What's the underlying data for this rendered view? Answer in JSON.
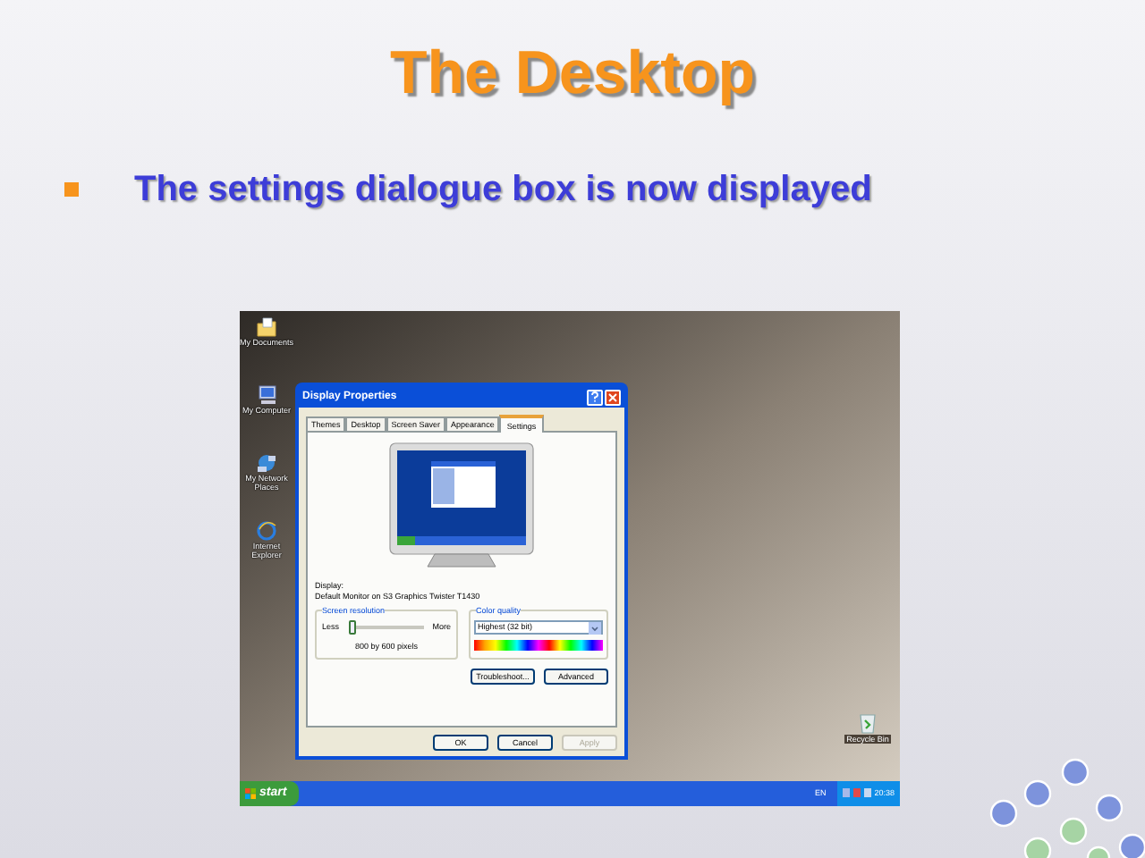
{
  "slide": {
    "title": "The Desktop",
    "bullets": [
      "The settings dialogue box is now displayed"
    ]
  },
  "desktop": {
    "icons": [
      {
        "label": "My Documents",
        "kind": "folder"
      },
      {
        "label": "My Computer",
        "kind": "computer"
      },
      {
        "label": "My Network Places",
        "kind": "network"
      },
      {
        "label": "Internet Explorer",
        "kind": "browser"
      }
    ],
    "recycle_bin": {
      "label": "Recycle Bin"
    }
  },
  "dialog": {
    "title": "Display Properties",
    "tabs": [
      {
        "label": "Themes",
        "selected": false
      },
      {
        "label": "Desktop",
        "selected": false
      },
      {
        "label": "Screen Saver",
        "selected": false
      },
      {
        "label": "Appearance",
        "selected": false
      },
      {
        "label": "Settings",
        "selected": true
      }
    ],
    "display_label": "Display:",
    "display_value": "Default Monitor on S3 Graphics Twister T1430",
    "resolution": {
      "legend": "Screen resolution",
      "less": "Less",
      "more": "More",
      "level": 0.05,
      "reading": "800 by 600 pixels"
    },
    "color_quality": {
      "legend": "Color quality",
      "value": "Highest (32 bit)"
    },
    "buttons": [
      {
        "label": "Troubleshoot...",
        "disabled": false
      },
      {
        "label": "Advanced",
        "disabled": false
      }
    ],
    "footer_buttons": [
      {
        "label": "OK",
        "disabled": false
      },
      {
        "label": "Cancel",
        "disabled": false
      },
      {
        "label": "Apply",
        "disabled": true
      }
    ]
  },
  "taskbar": {
    "start": "start",
    "language": "EN",
    "clock": "20:38"
  }
}
